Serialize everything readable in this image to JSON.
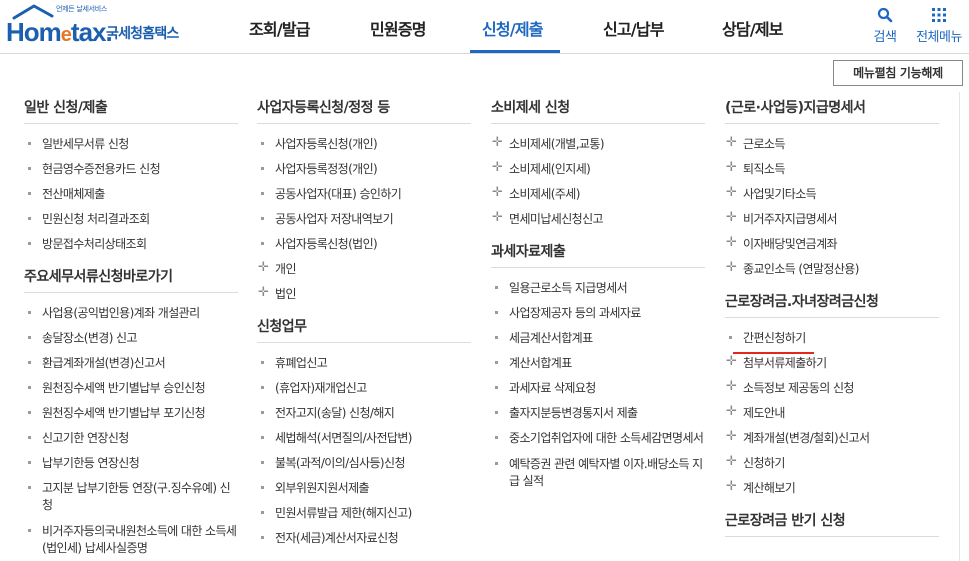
{
  "logo": {
    "tagline": "언제든 날세서비스",
    "brand": "Hom",
    "brand_e": "e",
    "brand_rest": "tax.",
    "kr": "국세청홈택스"
  },
  "gnb": [
    "조회/발급",
    "민원증명",
    "신청/제출",
    "신고/납부",
    "상담/제보"
  ],
  "util": {
    "search": "검색",
    "menu": "전체메뉴"
  },
  "collapse_button": "메뉴펼침 기능해제",
  "col1": {
    "sec1_title": "일반 신청/제출",
    "sec1_items": [
      "일반세무서류 신청",
      "현금영수증전용카드 신청",
      "전산매체제출",
      "민원신청 처리결과조회",
      "방문접수처리상태조회"
    ],
    "sec2_title": "주요세무서류신청바로가기",
    "sec2_items": [
      "사업용(공익법인용)계좌 개설관리",
      "송달장소(변경) 신고",
      "환급계좌개설(변경)신고서",
      "원천징수세액 반기별납부 승인신청",
      "원천징수세액 반기별납부 포기신청",
      "신고기한 연장신청",
      "납부기한등 연장신청",
      "고지분 납부기한등 연장(구.징수유예) 신청",
      "비거주자등의국내원천소득에 대한 소득세(법인세) 납세사실증명"
    ]
  },
  "col2": {
    "sec1_title": "사업자등록신청/정정 등",
    "sec1_items": [
      "사업자등록신청(개인)",
      "사업자등록정정(개인)",
      "공동사업자(대표) 승인하기",
      "공동사업자 저장내역보기",
      "사업자등록신청(법인)"
    ],
    "sec1_plus_items": [
      "개인",
      "법인"
    ],
    "sec2_title": "신청업무",
    "sec2_items": [
      "휴폐업신고",
      "(휴업자)재개업신고",
      "전자고지(송달) 신청/해지",
      "세법해석(서면질의/사전답변)",
      "불복(과적/이의/심사등)신청",
      "외부위원지원서제출",
      "민원서류발급 제한(해지신고)",
      "전자(세금)계산서자료신청"
    ]
  },
  "col3": {
    "sec1_title": "소비제세 신청",
    "sec1_items": [
      "소비제세(개별,교통)",
      "소비제세(인지세)",
      "소비제세(주세)",
      "면세미납세신청신고"
    ],
    "sec2_title": "과세자료제출",
    "sec2_items": [
      "일용근로소득 지급명세서",
      "사업장제공자 등의 과세자료",
      "세금계산서합계표",
      "계산서합계표",
      "과세자료 삭제요청",
      "출자지분등변경통지서 제출",
      "중소기업취업자에 대한 소득세감면명세서",
      "예탁증권 관련 예탁자별 이자.배당소득 지급 실적"
    ]
  },
  "col4": {
    "sec1_title": "(근로·사업등)지급명세서",
    "sec1_items": [
      "근로소득",
      "퇴직소득",
      "사업및기타소득",
      "비거주자지급명세서",
      "이자배당및연금계좌",
      "종교인소득 (연말정산용)"
    ],
    "sec2_title": "근로장려금.자녀장려금신청",
    "sec2_items": [
      "간편신청하기"
    ],
    "sec2_plus_items": [
      "첨부서류제출하기",
      "소득정보 제공동의 신청",
      "제도안내",
      "계좌개설(변경/철회)신고서",
      "신청하기",
      "계산해보기"
    ],
    "sec3_title": "근로장려금 반기 신청"
  },
  "colors": {
    "brand_blue": "#1b5fae",
    "active_blue": "#1f68c1",
    "highlight_red": "#e3271b",
    "orange": "#e87722"
  },
  "icons": [
    "house-roof-icon",
    "search-icon",
    "grid-menu-icon",
    "bullet-square-icon",
    "plus-cross-icon"
  ]
}
